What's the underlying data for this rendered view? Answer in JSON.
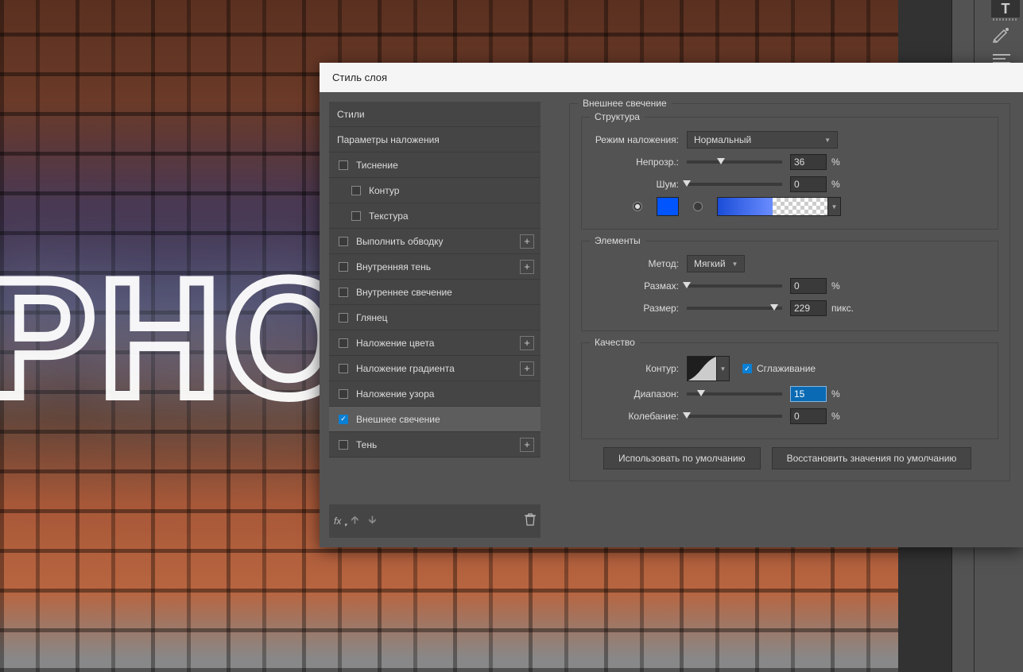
{
  "canvas": {
    "text": "PHO"
  },
  "dialog": {
    "title": "Стиль слоя",
    "left": {
      "styles": "Стили",
      "blendOpts": "Параметры наложения",
      "bevel": "Тиснение",
      "contour": "Контур",
      "texture": "Текстура",
      "stroke": "Выполнить обводку",
      "innerShadow": "Внутренняя тень",
      "innerGlow": "Внутреннее свечение",
      "satin": "Глянец",
      "colorOverlay": "Наложение цвета",
      "gradOverlay": "Наложение градиента",
      "patternOverlay": "Наложение узора",
      "outerGlow": "Внешнее свечение",
      "dropShadow": "Тень"
    },
    "right": {
      "panelTitle": "Внешнее свечение",
      "structure": {
        "title": "Структура",
        "blendMode": "Режим наложения:",
        "blendModeVal": "Нормальный",
        "opacity": "Непрозр.:",
        "opacityVal": "36",
        "noise": "Шум:",
        "noiseVal": "0",
        "pct": "%"
      },
      "elements": {
        "title": "Элементы",
        "technique": "Метод:",
        "techniqueVal": "Мягкий",
        "spread": "Размах:",
        "spreadVal": "0",
        "size": "Размер:",
        "sizeVal": "229",
        "px": "пикс.",
        "pct": "%"
      },
      "quality": {
        "title": "Качество",
        "contour": "Контур:",
        "antialias": "Сглаживание",
        "range": "Диапазон:",
        "rangeVal": "15",
        "jitter": "Колебание:",
        "jitterVal": "0",
        "pct": "%"
      },
      "btnDefault": "Использовать по умолчанию",
      "btnReset": "Восстановить значения по умолчанию"
    }
  },
  "rightPanel": {
    "tLabel": "T"
  }
}
